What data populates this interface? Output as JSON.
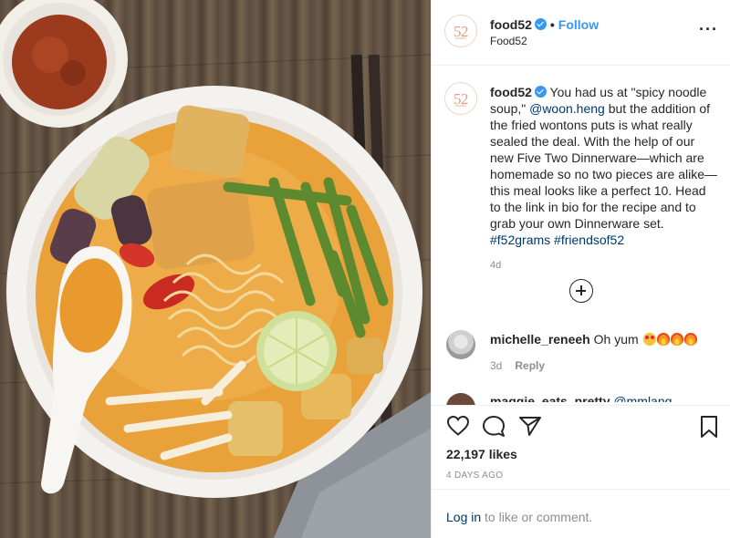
{
  "post": {
    "image_alt_icon": "noodle-soup-photo",
    "header": {
      "logo_text": "52",
      "logo_subtext": "food52",
      "username": "food52",
      "separator": "•",
      "follow_label": "Follow",
      "subtitle": "Food52",
      "more_label": "···"
    },
    "caption": {
      "username": "food52",
      "text_1": " You had us at \"spicy noodle soup,\" ",
      "mention": "@woon.heng",
      "text_2": " but the addition of the fried wontons puts is what really sealed the deal. With the help of our new Five Two Dinnerware—which are homemade so no two pieces are alike—this meal looks like a perfect 10. Head to the link in bio for the recipe and to grab your own Dinnerware set. ",
      "hashtag_1": "#f52grams",
      "hashtag_2": "#friendsof52",
      "time": "4d"
    },
    "comments": [
      {
        "username": "michelle_reneeh",
        "text": "Oh yum",
        "emojis": [
          "heart-eyes",
          "fire",
          "fire",
          "fire"
        ],
        "time": "3d",
        "reply_label": "Reply"
      },
      {
        "username": "maggie_eats_pretty",
        "text": "@mmlang..."
      }
    ],
    "likes": "22,197 likes",
    "posted_ago": "4 DAYS AGO",
    "login": {
      "link": "Log in",
      "rest": " to like or comment."
    },
    "colors": {
      "accent": "#3897f0",
      "link": "#00376b",
      "muted": "#8e8e8e",
      "border": "#efefef"
    }
  }
}
